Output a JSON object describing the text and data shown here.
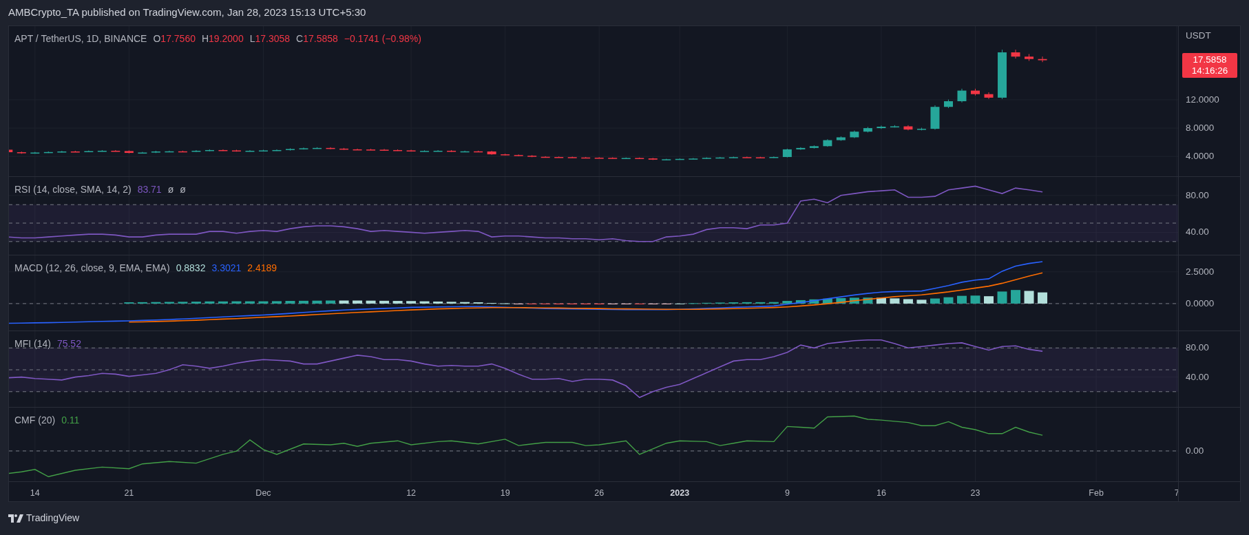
{
  "header": {
    "text": "AMBCrypto_TA published on TradingView.com, Jan 28, 2023 15:13 UTC+5:30"
  },
  "panes": [
    {
      "kind": "price",
      "legend": {
        "title": "APT / TetherUS, 1D, BINANCE",
        "values": [
          {
            "prefix": "O",
            "value": "17.7560",
            "color": "#f23645"
          },
          {
            "prefix": "H",
            "value": "19.2000",
            "color": "#f23645"
          },
          {
            "prefix": "L",
            "value": "17.3058",
            "color": "#f23645"
          },
          {
            "prefix": "C",
            "value": "17.5858",
            "color": "#f23645"
          },
          {
            "value": "−0.1741 (−0.98%)",
            "color": "#f23645"
          }
        ]
      },
      "axis_unit": "USDT",
      "last_price": {
        "price": "17.5858",
        "countdown": "14:16:26"
      },
      "axis_ticks": [
        "12.0000",
        "8.0000",
        "4.0000"
      ]
    },
    {
      "kind": "rsi",
      "legend": {
        "title": "RSI (14, close, SMA, 14, 2)",
        "values": [
          {
            "value": "83.71",
            "color": "#7e57c2"
          },
          {
            "value": "ø",
            "color": "#b2b5be"
          },
          {
            "value": "ø",
            "color": "#b2b5be"
          }
        ]
      },
      "axis_ticks": [
        "80.00",
        "40.00"
      ]
    },
    {
      "kind": "macd",
      "legend": {
        "title": "MACD (12, 26, close, 9, EMA, EMA)",
        "values": [
          {
            "value": "0.8832",
            "color": "#b2dfdb"
          },
          {
            "value": "3.3021",
            "color": "#2962ff"
          },
          {
            "value": "2.4189",
            "color": "#ff6d00"
          }
        ]
      },
      "axis_ticks": [
        "2.5000",
        "0.0000"
      ]
    },
    {
      "kind": "mfi",
      "legend": {
        "title": "MFI (14)",
        "values": [
          {
            "value": "75.52",
            "color": "#7e57c2"
          }
        ]
      },
      "axis_ticks": [
        "80.00",
        "40.00"
      ]
    },
    {
      "kind": "cmf",
      "legend": {
        "title": "CMF (20)",
        "values": [
          {
            "value": "0.11",
            "color": "#43a047"
          }
        ]
      },
      "axis_ticks": [
        "0.00"
      ]
    }
  ],
  "time_axis": [
    {
      "label": "14",
      "kind": "day"
    },
    {
      "label": "21",
      "kind": "day"
    },
    {
      "label": "Dec",
      "kind": "month"
    },
    {
      "label": "12",
      "kind": "day"
    },
    {
      "label": "19",
      "kind": "day"
    },
    {
      "label": "26",
      "kind": "day"
    },
    {
      "label": "2023",
      "kind": "year"
    },
    {
      "label": "9",
      "kind": "day"
    },
    {
      "label": "16",
      "kind": "day"
    },
    {
      "label": "23",
      "kind": "day"
    },
    {
      "label": "Feb",
      "kind": "month"
    },
    {
      "label": "7",
      "kind": "day"
    }
  ],
  "footer": {
    "brand": "TradingView"
  }
}
